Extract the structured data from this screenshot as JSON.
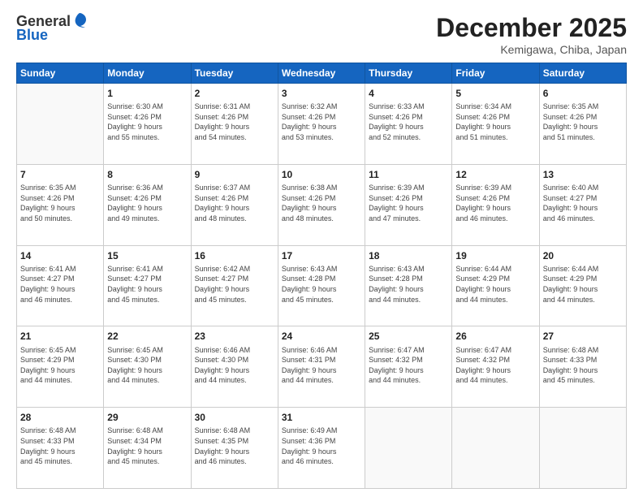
{
  "header": {
    "logo_line1": "General",
    "logo_line2": "Blue",
    "month_title": "December 2025",
    "location": "Kemigawa, Chiba, Japan"
  },
  "weekdays": [
    "Sunday",
    "Monday",
    "Tuesday",
    "Wednesday",
    "Thursday",
    "Friday",
    "Saturday"
  ],
  "weeks": [
    [
      {
        "day": "",
        "info": ""
      },
      {
        "day": "1",
        "info": "Sunrise: 6:30 AM\nSunset: 4:26 PM\nDaylight: 9 hours\nand 55 minutes."
      },
      {
        "day": "2",
        "info": "Sunrise: 6:31 AM\nSunset: 4:26 PM\nDaylight: 9 hours\nand 54 minutes."
      },
      {
        "day": "3",
        "info": "Sunrise: 6:32 AM\nSunset: 4:26 PM\nDaylight: 9 hours\nand 53 minutes."
      },
      {
        "day": "4",
        "info": "Sunrise: 6:33 AM\nSunset: 4:26 PM\nDaylight: 9 hours\nand 52 minutes."
      },
      {
        "day": "5",
        "info": "Sunrise: 6:34 AM\nSunset: 4:26 PM\nDaylight: 9 hours\nand 51 minutes."
      },
      {
        "day": "6",
        "info": "Sunrise: 6:35 AM\nSunset: 4:26 PM\nDaylight: 9 hours\nand 51 minutes."
      }
    ],
    [
      {
        "day": "7",
        "info": "Sunrise: 6:35 AM\nSunset: 4:26 PM\nDaylight: 9 hours\nand 50 minutes."
      },
      {
        "day": "8",
        "info": "Sunrise: 6:36 AM\nSunset: 4:26 PM\nDaylight: 9 hours\nand 49 minutes."
      },
      {
        "day": "9",
        "info": "Sunrise: 6:37 AM\nSunset: 4:26 PM\nDaylight: 9 hours\nand 48 minutes."
      },
      {
        "day": "10",
        "info": "Sunrise: 6:38 AM\nSunset: 4:26 PM\nDaylight: 9 hours\nand 48 minutes."
      },
      {
        "day": "11",
        "info": "Sunrise: 6:39 AM\nSunset: 4:26 PM\nDaylight: 9 hours\nand 47 minutes."
      },
      {
        "day": "12",
        "info": "Sunrise: 6:39 AM\nSunset: 4:26 PM\nDaylight: 9 hours\nand 46 minutes."
      },
      {
        "day": "13",
        "info": "Sunrise: 6:40 AM\nSunset: 4:27 PM\nDaylight: 9 hours\nand 46 minutes."
      }
    ],
    [
      {
        "day": "14",
        "info": "Sunrise: 6:41 AM\nSunset: 4:27 PM\nDaylight: 9 hours\nand 46 minutes."
      },
      {
        "day": "15",
        "info": "Sunrise: 6:41 AM\nSunset: 4:27 PM\nDaylight: 9 hours\nand 45 minutes."
      },
      {
        "day": "16",
        "info": "Sunrise: 6:42 AM\nSunset: 4:27 PM\nDaylight: 9 hours\nand 45 minutes."
      },
      {
        "day": "17",
        "info": "Sunrise: 6:43 AM\nSunset: 4:28 PM\nDaylight: 9 hours\nand 45 minutes."
      },
      {
        "day": "18",
        "info": "Sunrise: 6:43 AM\nSunset: 4:28 PM\nDaylight: 9 hours\nand 44 minutes."
      },
      {
        "day": "19",
        "info": "Sunrise: 6:44 AM\nSunset: 4:29 PM\nDaylight: 9 hours\nand 44 minutes."
      },
      {
        "day": "20",
        "info": "Sunrise: 6:44 AM\nSunset: 4:29 PM\nDaylight: 9 hours\nand 44 minutes."
      }
    ],
    [
      {
        "day": "21",
        "info": "Sunrise: 6:45 AM\nSunset: 4:29 PM\nDaylight: 9 hours\nand 44 minutes."
      },
      {
        "day": "22",
        "info": "Sunrise: 6:45 AM\nSunset: 4:30 PM\nDaylight: 9 hours\nand 44 minutes."
      },
      {
        "day": "23",
        "info": "Sunrise: 6:46 AM\nSunset: 4:30 PM\nDaylight: 9 hours\nand 44 minutes."
      },
      {
        "day": "24",
        "info": "Sunrise: 6:46 AM\nSunset: 4:31 PM\nDaylight: 9 hours\nand 44 minutes."
      },
      {
        "day": "25",
        "info": "Sunrise: 6:47 AM\nSunset: 4:32 PM\nDaylight: 9 hours\nand 44 minutes."
      },
      {
        "day": "26",
        "info": "Sunrise: 6:47 AM\nSunset: 4:32 PM\nDaylight: 9 hours\nand 44 minutes."
      },
      {
        "day": "27",
        "info": "Sunrise: 6:48 AM\nSunset: 4:33 PM\nDaylight: 9 hours\nand 45 minutes."
      }
    ],
    [
      {
        "day": "28",
        "info": "Sunrise: 6:48 AM\nSunset: 4:33 PM\nDaylight: 9 hours\nand 45 minutes."
      },
      {
        "day": "29",
        "info": "Sunrise: 6:48 AM\nSunset: 4:34 PM\nDaylight: 9 hours\nand 45 minutes."
      },
      {
        "day": "30",
        "info": "Sunrise: 6:48 AM\nSunset: 4:35 PM\nDaylight: 9 hours\nand 46 minutes."
      },
      {
        "day": "31",
        "info": "Sunrise: 6:49 AM\nSunset: 4:36 PM\nDaylight: 9 hours\nand 46 minutes."
      },
      {
        "day": "",
        "info": ""
      },
      {
        "day": "",
        "info": ""
      },
      {
        "day": "",
        "info": ""
      }
    ]
  ]
}
